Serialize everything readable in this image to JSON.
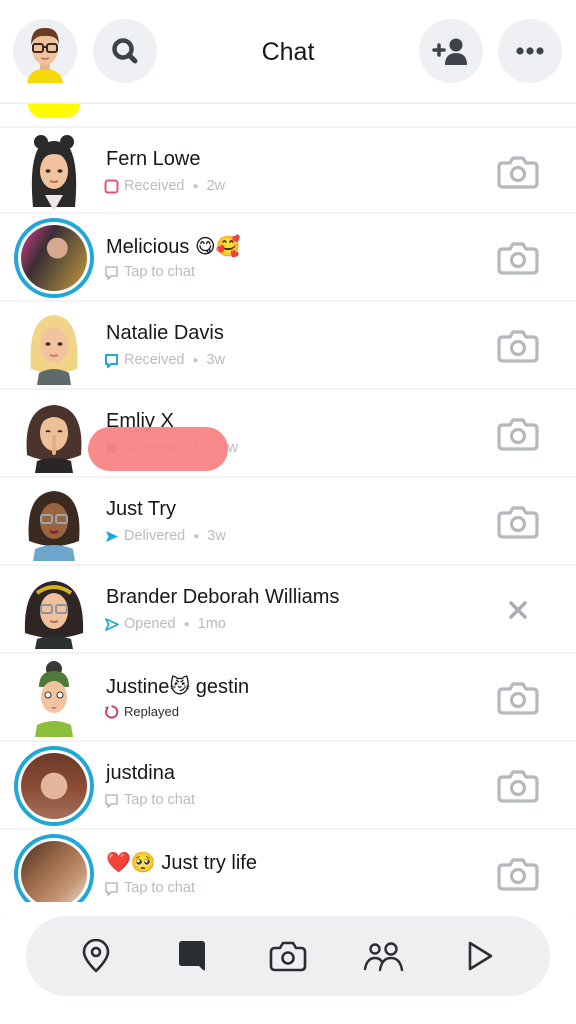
{
  "header": {
    "title": "Chat",
    "buttons": {
      "profile": "profile-avatar",
      "search": "search-icon",
      "add_friend": "add-friend-icon",
      "more": "more-icon"
    }
  },
  "colors": {
    "story_ring": "#1fa7d8",
    "received_chat": "#1fa7d8",
    "received_snap": "#e0576f",
    "delivered": "#1fa7d8",
    "replayed": "#c6356b",
    "highlight": "#f98082",
    "bitmoji_yellow": "#fffc00"
  },
  "chats": [
    {
      "name": "Fern Lowe",
      "status": "Received",
      "time": "2w",
      "status_icon": "square-outline-icon",
      "action": "camera"
    },
    {
      "name": "Melicious 😋🥰",
      "status": "Tap to chat",
      "time": "",
      "status_icon": "chat-bubble-outline-icon",
      "action": "camera",
      "story": true
    },
    {
      "name": "Natalie Davis",
      "status": "Received",
      "time": "3w",
      "status_icon": "chat-bubble-blue-icon",
      "action": "camera"
    },
    {
      "name": "Emliy X",
      "status": "Screenshot",
      "time": "3w",
      "status_icon": "screenshot-icon",
      "action": "camera"
    },
    {
      "name": "Just Try",
      "status": "Delivered",
      "time": "3w",
      "status_icon": "arrow-filled-icon",
      "action": "camera"
    },
    {
      "name": "Brander Deborah Williams",
      "status": "Opened",
      "time": "1mo",
      "status_icon": "arrow-outline-icon",
      "action": "close"
    },
    {
      "name": "Justine😼 gestin",
      "status": "Replayed",
      "time": "",
      "status_icon": "replay-icon",
      "action": "camera"
    },
    {
      "name": "justdina",
      "status": "Tap to chat",
      "time": "",
      "status_icon": "chat-bubble-outline-icon",
      "action": "camera",
      "story": true
    },
    {
      "name": "❤️🥺 Just try life",
      "status": "Tap to chat",
      "time": "",
      "status_icon": "chat-bubble-outline-icon",
      "action": "camera",
      "story": true
    }
  ],
  "bottom_nav": [
    "map",
    "chat",
    "camera",
    "stories",
    "spotlight"
  ]
}
